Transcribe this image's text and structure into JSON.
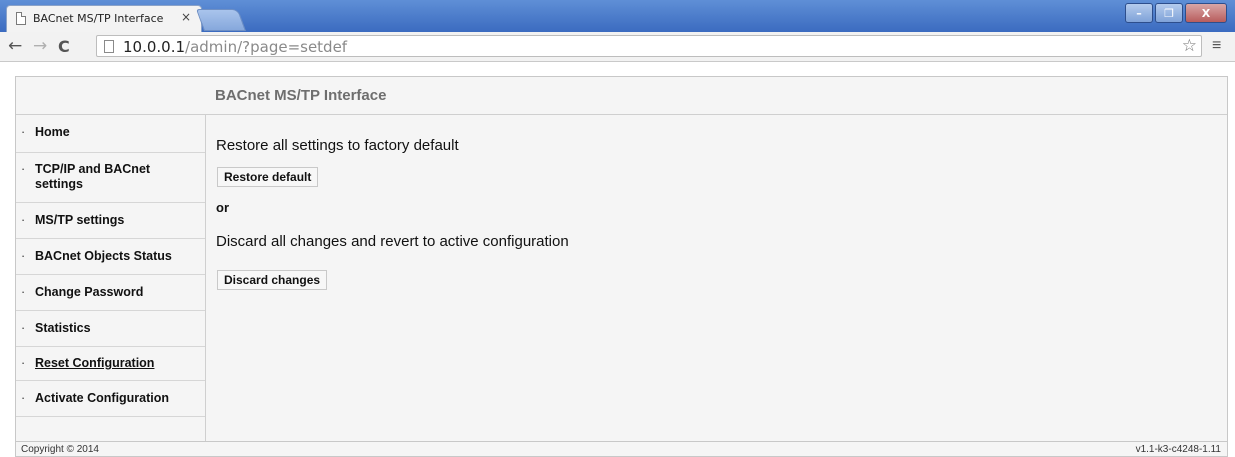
{
  "browser": {
    "tab_title": "BACnet MS/TP Interface",
    "tab_close": "×",
    "url_host": "10.0.0.1",
    "url_path": "/admin/?page=setdef",
    "window_buttons": [
      "–",
      "❐",
      "X"
    ]
  },
  "header": {
    "title": "BACnet MS/TP Interface"
  },
  "sidebar": {
    "bullet": "·",
    "items": [
      {
        "label": "Home"
      },
      {
        "label": "TCP/IP and BACnet settings"
      },
      {
        "label": "MS/TP settings"
      },
      {
        "label": "BACnet Objects Status"
      },
      {
        "label": "Change Password"
      },
      {
        "label": "Statistics"
      },
      {
        "label": "Reset Configuration",
        "current": true
      },
      {
        "label": "Activate Configuration"
      }
    ]
  },
  "main": {
    "restore_heading": "Restore all settings to factory default",
    "restore_button": "Restore default",
    "or_text": "or",
    "discard_heading": "Discard all changes and revert to active configuration",
    "discard_button": "Discard changes"
  },
  "footer": {
    "copyright": "Copyright © 2014",
    "version": "v1.1-k3-c4248-1.11"
  }
}
